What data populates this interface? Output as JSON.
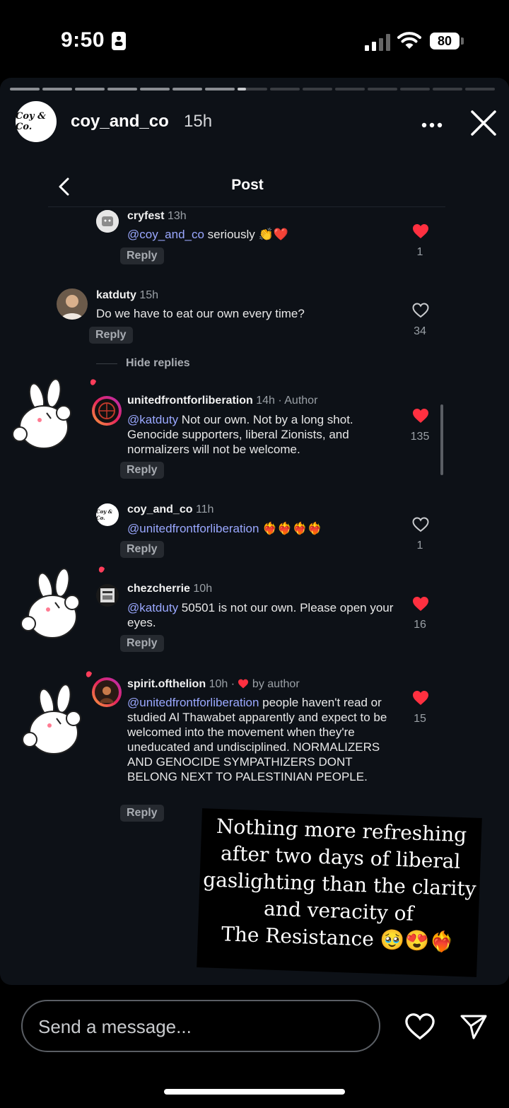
{
  "status_bar": {
    "time": "9:50",
    "battery": "80"
  },
  "story": {
    "username": "coy_and_co",
    "age": "15h",
    "avatar_text": "Coy & Co.",
    "segments_total": 15,
    "segments_done": 7
  },
  "post": {
    "title": "Post",
    "hide_replies": "Hide replies",
    "comments": [
      {
        "user": "cryfest",
        "meta": "13h",
        "mention": "@coy_and_co",
        "text": " seriously 👏❤️",
        "likes": "1",
        "liked": true,
        "reply": "Reply"
      },
      {
        "user": "katduty",
        "meta": "15h",
        "mention": "",
        "text": "Do we have to eat our own every time?",
        "likes": "34",
        "liked": false,
        "reply": "Reply"
      },
      {
        "user": "unitedfrontforliberation",
        "meta": "14h · Author",
        "mention": "@katduty",
        "text": " Not our own. Not by a long shot. Genocide supporters, liberal Zionists, and normalizers will not be welcome.",
        "likes": "135",
        "liked": true,
        "reply": "Reply"
      },
      {
        "user": "coy_and_co",
        "meta": "11h",
        "mention": "@unitedfrontforliberation",
        "text": " ❤️‍🔥❤️‍🔥❤️‍🔥❤️‍🔥",
        "likes": "1",
        "liked": false,
        "reply": "Reply"
      },
      {
        "user": "chezcherrie",
        "meta": "10h",
        "mention": "@katduty",
        "text": " 50501 is not our own. Please open your eyes.",
        "likes": "16",
        "liked": true,
        "reply": "Reply"
      },
      {
        "user": "spirit.ofthelion",
        "meta": "10h · ",
        "meta2": " by author",
        "mention": "@unitedfrontforliberation",
        "text": " people haven't read or studied Al Thawabet apparently and expect to be welcomed into the movement when they're uneducated and undisciplined. NORMALIZERS AND GENOCIDE SYMPATHIZERS DONT BELONG NEXT TO PALESTINIAN PEOPLE.",
        "likes": "15",
        "liked": true,
        "reply": "Reply"
      }
    ]
  },
  "caption": {
    "lines": [
      "Nothing more refreshing",
      "after two days of liberal",
      "gaslighting than the clarity",
      "and veracity of",
      "The Resistance 🥹😍❤️‍🔥"
    ]
  },
  "bottom": {
    "placeholder": "Send a message..."
  },
  "colors": {
    "like_red": "#ff3040",
    "mention": "#9aa8ff",
    "story_bg": "#0d1117"
  }
}
